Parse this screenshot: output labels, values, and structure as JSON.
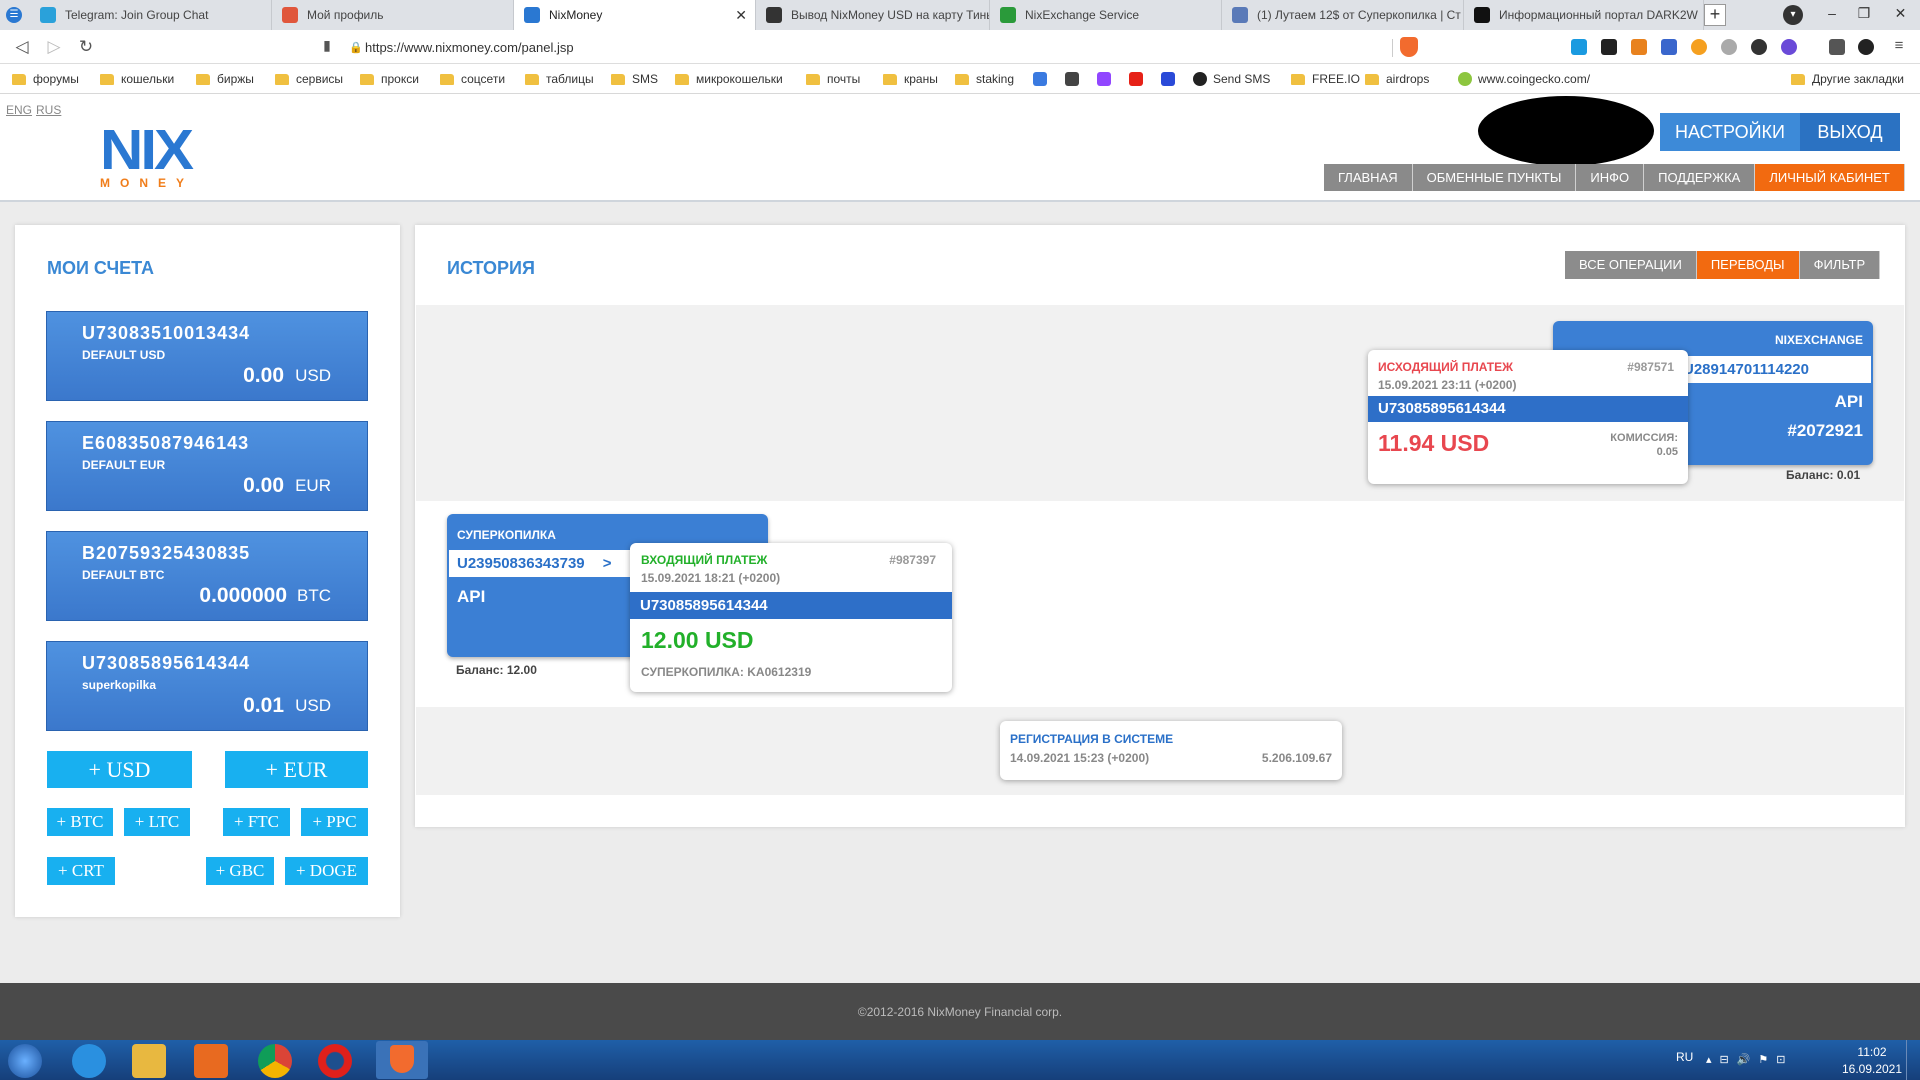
{
  "browser": {
    "tabs": [
      {
        "title": "Telegram: Join Group Chat",
        "icon": "telegram-icon",
        "color": "#2aa1da"
      },
      {
        "title": "Мой профиль",
        "icon": "profile-icon",
        "color": "#e0563b"
      },
      {
        "title": "NixMoney",
        "icon": "nixmoney-icon",
        "color": "#2a78d2",
        "active": true
      },
      {
        "title": "Вывод NixMoney USD на карту Тинь",
        "icon": "bc-icon",
        "color": "#333333"
      },
      {
        "title": "NixExchange Service",
        "icon": "nixexchange-icon",
        "color": "#2a9a3a"
      },
      {
        "title": "(1) Лутаем 12$ от Суперкопилка | Ст",
        "icon": "forum-icon",
        "color": "#5a7ab8"
      },
      {
        "title": "Информационный портал DARK2W",
        "icon": "dark-icon",
        "color": "#111111"
      }
    ],
    "url": "https://www.nixmoney.com/panel.jsp",
    "bookmarks": [
      {
        "label": "форумы",
        "type": "folder"
      },
      {
        "label": "кошельки",
        "type": "folder"
      },
      {
        "label": "биржы",
        "type": "folder"
      },
      {
        "label": "сервисы",
        "type": "folder"
      },
      {
        "label": "прокси",
        "type": "folder"
      },
      {
        "label": "соцсети",
        "type": "folder"
      },
      {
        "label": "таблицы",
        "type": "folder"
      },
      {
        "label": "SMS",
        "type": "folder"
      },
      {
        "label": "микрокошельки",
        "type": "folder"
      },
      {
        "label": "почты",
        "type": "folder"
      },
      {
        "label": "краны",
        "type": "folder"
      },
      {
        "label": "staking",
        "type": "folder"
      },
      {
        "label": "Send SMS",
        "type": "site"
      },
      {
        "label": "FREE.IO",
        "type": "folder"
      },
      {
        "label": "airdrops",
        "type": "folder"
      },
      {
        "label": "www.coingecko.com/",
        "type": "site"
      }
    ],
    "other_bookmarks": "Другие закладки"
  },
  "header": {
    "lang_eng": "ENG",
    "lang_rus": "RUS",
    "logo_top": "NIX",
    "logo_bottom": "MONEY",
    "settings": "НАСТРОЙКИ",
    "logout": "ВЫХОД",
    "nav": [
      "ГЛАВНАЯ",
      "ОБМЕННЫЕ ПУНКТЫ",
      "ИНФО",
      "ПОДДЕРЖКА",
      "ЛИЧНЫЙ КАБИНЕТ"
    ]
  },
  "accounts": {
    "title": "МОИ СЧЕТА",
    "items": [
      {
        "id": "U73083510013434",
        "label": "DEFAULT USD",
        "amount": "0.00",
        "currency": "USD"
      },
      {
        "id": "E60835087946143",
        "label": "DEFAULT EUR",
        "amount": "0.00",
        "currency": "EUR"
      },
      {
        "id": "B20759325430835",
        "label": "DEFAULT BTC",
        "amount": "0.000000",
        "currency": "BTC"
      },
      {
        "id": "U73085895614344",
        "label": "superkopilka",
        "amount": "0.01",
        "currency": "USD"
      }
    ],
    "add_buttons": [
      "+ USD",
      "+ EUR",
      "+ BTC",
      "+ LTC",
      "+ FTC",
      "+ PPC",
      "+ CRT",
      "+ GBC",
      "+ DOGE"
    ]
  },
  "history": {
    "title": "ИСТОРИЯ",
    "filters": [
      "ВСЕ ОПЕРАЦИИ",
      "ПЕРЕВОДЫ",
      "ФИЛЬТР"
    ],
    "tx1": {
      "counterparty_name": "NIXEXCHANGE",
      "counterparty_arrow": ">",
      "counterparty_id": "U28914701114220",
      "type": "API",
      "ref": "#2072921",
      "balance": "Баланс: 0.01",
      "title": "ИСХОДЯЩИЙ ПЛАТЕЖ",
      "number": "#987571",
      "date": "15.09.2021 23:11 (+0200)",
      "account": "U73085895614344",
      "amount": "11.94 USD",
      "fee_label": "КОМИССИЯ:",
      "fee": "0.05"
    },
    "tx2": {
      "counterparty_name": "СУПЕРКОПИЛКА",
      "counterparty_id": "U23950836343739",
      "counterparty_arrow": ">",
      "type": "API",
      "balance": "Баланс: 12.00",
      "title": "ВХОДЯЩИЙ ПЛАТЕЖ",
      "number": "#987397",
      "date": "15.09.2021 18:21 (+0200)",
      "account": "U73085895614344",
      "amount": "12.00 USD",
      "note": "СУПЕРКОПИЛКА: KA0612319"
    },
    "registration": {
      "title": "РЕГИСТРАЦИЯ В СИСТЕМЕ",
      "date": "14.09.2021 15:23 (+0200)",
      "value": "5.206.109.67"
    }
  },
  "footer": "©2012-2016 NixMoney Financial corp.",
  "taskbar": {
    "lang": "RU",
    "time": "11:02",
    "date": "16.09.2021"
  },
  "colors": {
    "accent_blue": "#3b7fd4",
    "orange": "#f26a10",
    "red_amount": "#e8474f",
    "green_amount": "#22b02a"
  }
}
